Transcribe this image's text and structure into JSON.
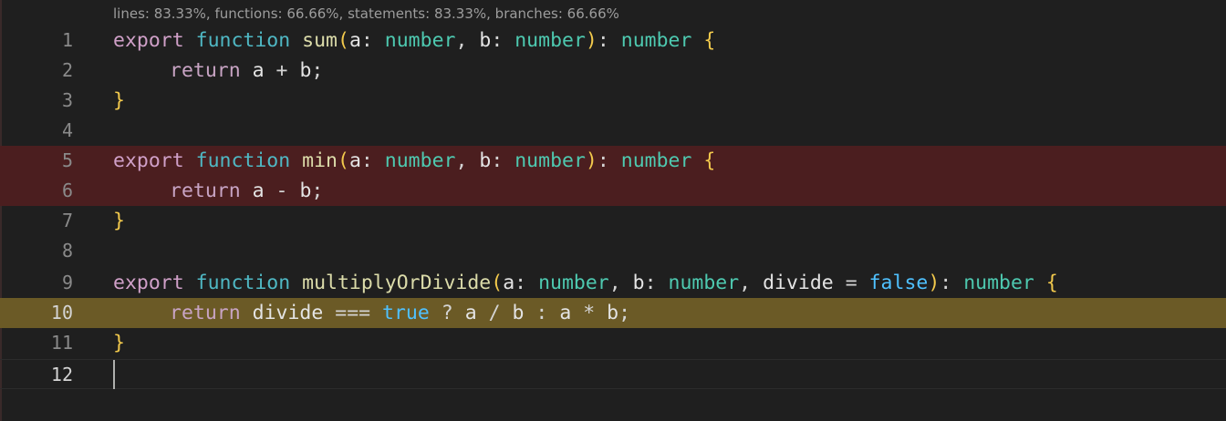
{
  "codelens": "lines: 83.33%, functions: 66.66%, statements: 83.33%, branches: 66.66%",
  "line_numbers": [
    "1",
    "2",
    "3",
    "4",
    "5",
    "6",
    "7",
    "8",
    "9",
    "10",
    "11",
    "12"
  ],
  "tokens": {
    "export": "export",
    "function": "function",
    "return": "return",
    "sum": "sum",
    "min": "min",
    "multiplyOrDivide": "multiplyOrDivide",
    "a": "a",
    "b": "b",
    "number": "number",
    "divide": "divide",
    "false": "false",
    "true": "true",
    "open_paren": "(",
    "close_paren": ")",
    "colon": ":",
    "comma": ",",
    "open_brace": "{",
    "close_brace": "}",
    "semicolon": ";",
    "plus": "+",
    "minus": "-",
    "equals": "=",
    "strict_eq": "===",
    "question": "?",
    "slash": "/",
    "star": "*"
  },
  "colors": {
    "uncovered_background": "#4b1e1f",
    "partial_branch_background": "#6b5a26",
    "editor_background": "#1f1f1f"
  }
}
